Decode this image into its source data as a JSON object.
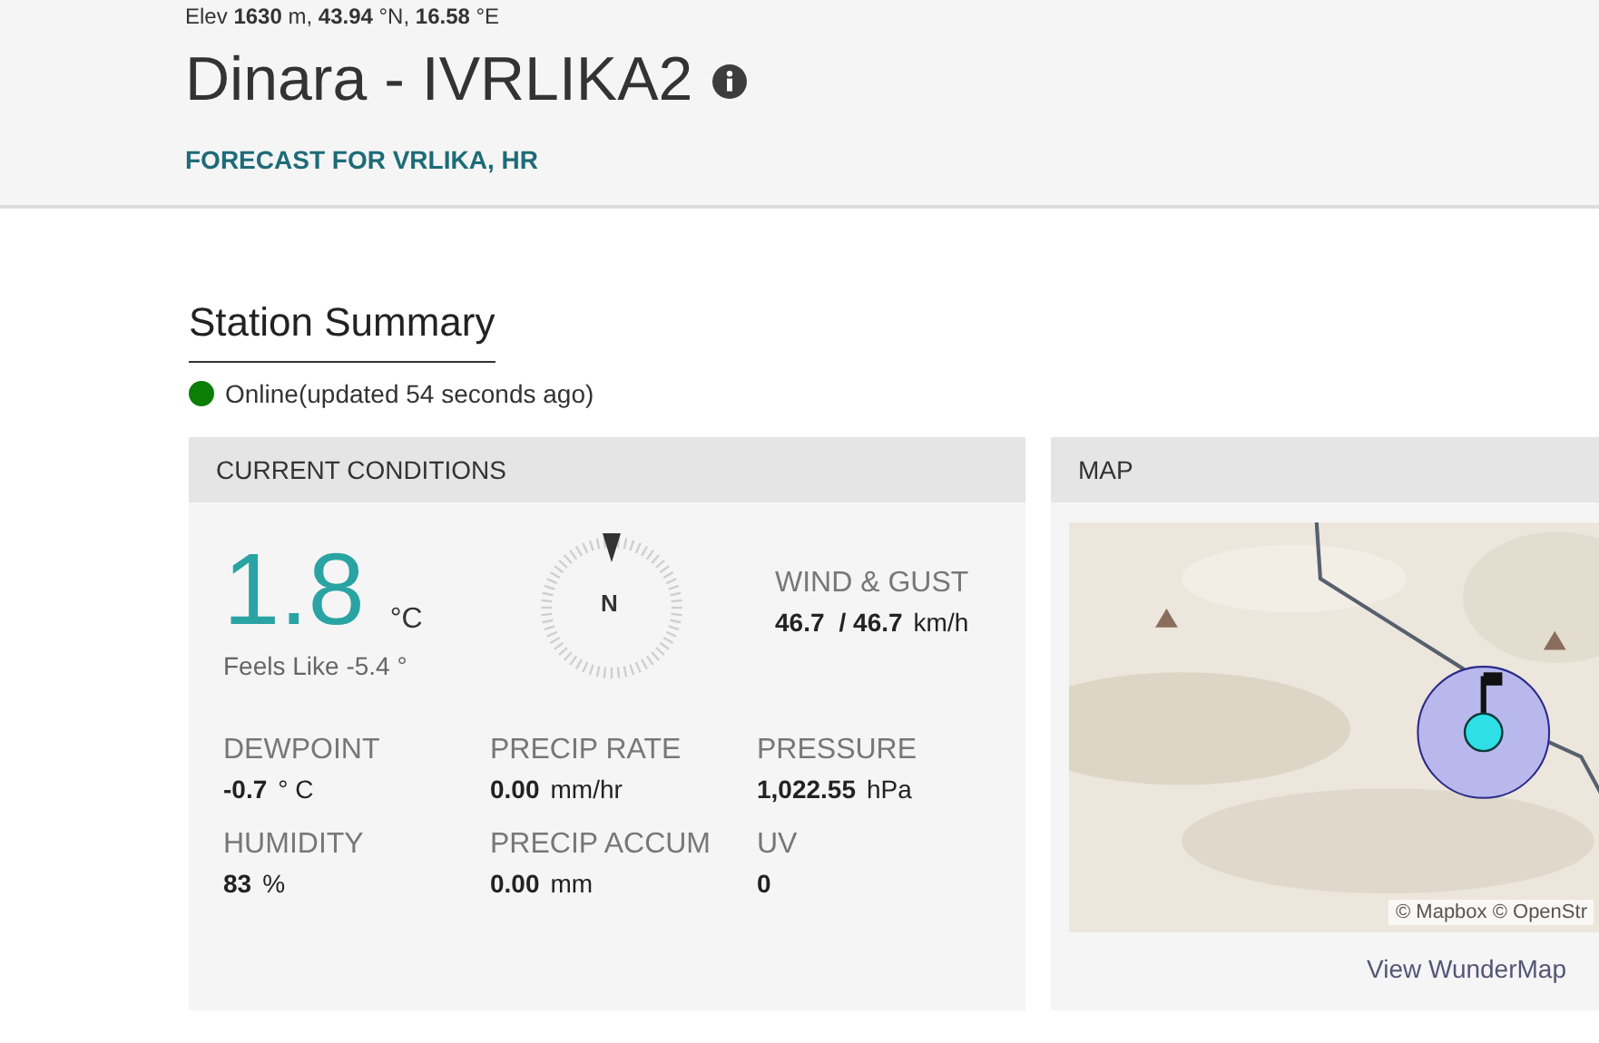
{
  "header": {
    "location": "Elev **1630** m, **43.94** °N, **16.58** °E",
    "title": "Dinara - IVRLIKA2",
    "forecast_link": "FORECAST FOR VRLIKA, HR"
  },
  "summary": {
    "heading": "Station Summary",
    "status": {
      "text": "Online(updated 54 seconds ago)",
      "color": "#0a7e07"
    }
  },
  "current_conditions": {
    "title": "CURRENT CONDITIONS",
    "temperature": "1.8",
    "temperature_unit": "°C",
    "feels_like": "Feels Like -5.4 °",
    "compass_label": "N",
    "wind_label": "WIND & GUST",
    "wind_value": "46.7",
    "gust_value": "/ 46.7",
    "wind_unit": "km/h",
    "metrics": [
      {
        "label": "DEWPOINT",
        "value": "-0.7",
        "unit": "° C"
      },
      {
        "label": "PRECIP RATE",
        "value": "0.00",
        "unit": "mm/hr"
      },
      {
        "label": "PRESSURE",
        "value": "1,022.55",
        "unit": "hPa"
      },
      {
        "label": "HUMIDITY",
        "value": "83",
        "unit": "%"
      },
      {
        "label": "PRECIP ACCUM",
        "value": "0.00",
        "unit": "mm"
      },
      {
        "label": "UV",
        "value": "0"
      }
    ]
  },
  "map": {
    "title": "MAP",
    "attribution": "© Mapbox © OpenStr",
    "link": "View WunderMap"
  }
}
